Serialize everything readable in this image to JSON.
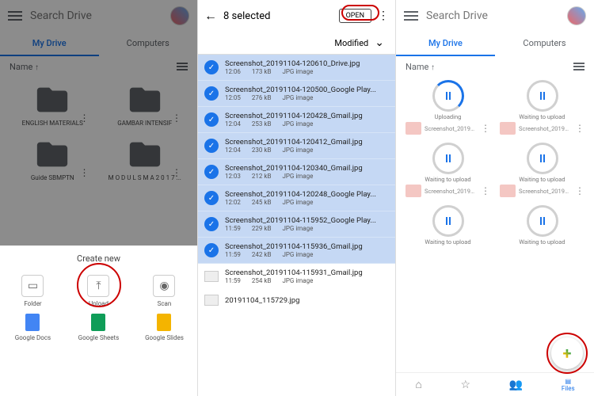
{
  "pane1": {
    "search_placeholder": "Search Drive",
    "tabs": {
      "mydrive": "My Drive",
      "computers": "Computers"
    },
    "sort": {
      "label": "Name",
      "dir": "↑"
    },
    "folders": [
      {
        "name": "ENGLISH MATERIALS"
      },
      {
        "name": "GAMBAR INTENSIF"
      },
      {
        "name": "Guide SBMPTN"
      },
      {
        "name": "M O D U L S M A 2 0 1 7 ..."
      }
    ],
    "sheet": {
      "title": "Create new",
      "opts": {
        "folder": "Folder",
        "upload": "Upload",
        "scan": "Scan",
        "docs": "Google Docs",
        "sheets": "Google Sheets",
        "slides": "Google Slides"
      }
    }
  },
  "pane2": {
    "title": "8 selected",
    "open": "OPEN",
    "sort": "Modified",
    "type_label": "JPG image",
    "selected": [
      {
        "name": "Screenshot_20191104-120610_Drive.jpg",
        "time": "12:06",
        "size": "173 kB"
      },
      {
        "name": "Screenshot_20191104-120500_Google Play...",
        "time": "12:05",
        "size": "276 kB"
      },
      {
        "name": "Screenshot_20191104-120428_Gmail.jpg",
        "time": "12:04",
        "size": "253 kB"
      },
      {
        "name": "Screenshot_20191104-120412_Gmail.jpg",
        "time": "12:04",
        "size": "230 kB"
      },
      {
        "name": "Screenshot_20191104-120340_Gmail.jpg",
        "time": "12:03",
        "size": "212 kB"
      },
      {
        "name": "Screenshot_20191104-120248_Google Play...",
        "time": "12:02",
        "size": "245 kB"
      },
      {
        "name": "Screenshot_20191104-115952_Google Play...",
        "time": "11:59",
        "size": "229 kB"
      },
      {
        "name": "Screenshot_20191104-115936_Gmail.jpg",
        "time": "11:59",
        "size": "242 kB"
      }
    ],
    "unselected": [
      {
        "name": "Screenshot_20191104-115931_Gmail.jpg",
        "time": "11:59",
        "size": "254 kB"
      },
      {
        "name": "20191104_115729.jpg",
        "time": "",
        "size": ""
      }
    ]
  },
  "pane3": {
    "search_placeholder": "Search Drive",
    "tabs": {
      "mydrive": "My Drive",
      "computers": "Computers"
    },
    "sort": {
      "label": "Name",
      "dir": "↑"
    },
    "status": {
      "uploading": "Uploading",
      "waiting": "Waiting to upload"
    },
    "file_label": "Screenshot_20191104-1...",
    "nav": {
      "files": "Files"
    }
  }
}
